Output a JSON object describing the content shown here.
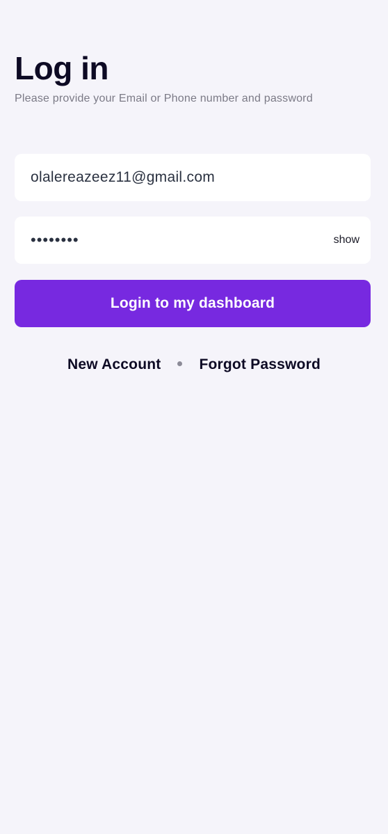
{
  "header": {
    "title": "Log in",
    "subtitle": "Please provide your Email or Phone number and password"
  },
  "form": {
    "email_value": "olalereazeez11@gmail.com",
    "password_value": "••••••••",
    "show_label": "show",
    "submit_label": "Login to my dashboard"
  },
  "links": {
    "new_account": "New Account",
    "forgot_password": "Forgot Password"
  },
  "colors": {
    "background": "#f5f4fa",
    "primary": "#7729e0",
    "field_background": "#ffffff"
  }
}
